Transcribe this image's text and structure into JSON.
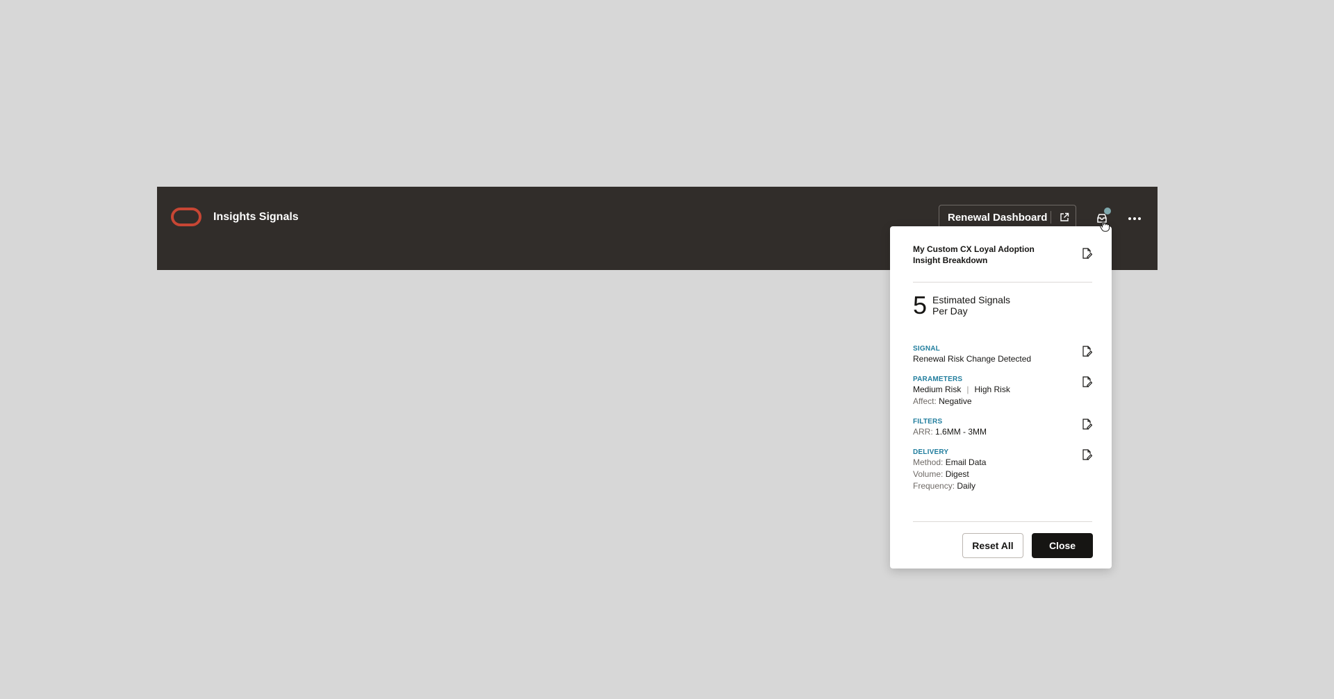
{
  "app_bar": {
    "title": "Insights Signals",
    "dashboard_button": "Renewal Dashboard",
    "icons": [
      "oracle-logo",
      "external-link-icon",
      "signal-inbox-icon",
      "more-options-icon"
    ],
    "colors": {
      "bar_background": "#312d2a",
      "logo": "#c74634",
      "notification_dot": "#7ea8ad"
    }
  },
  "popover": {
    "title": "My Custom CX Loyal Adoption Insight Breakdown",
    "metric": {
      "value": "5",
      "label": "Estimated Signals Per Day"
    },
    "signal": {
      "label": "SIGNAL",
      "value": "Renewal Risk Change Detected"
    },
    "parameters": {
      "label": "PARAMETERS",
      "risk_1": "Medium Risk",
      "separator": "|",
      "risk_2": "High Risk",
      "affect_key": "Affect:",
      "affect_value": "Negative"
    },
    "filters": {
      "label": "FILTERS",
      "arr_key": "ARR:",
      "arr_value": "1.6MM - 3MM"
    },
    "delivery": {
      "label": "DELIVERY",
      "method_key": "Method:",
      "method_value": "Email Data",
      "volume_key": "Volume:",
      "volume_value": "Digest",
      "frequency_key": "Frequency:",
      "frequency_value": "Daily"
    },
    "buttons": {
      "reset": "Reset All",
      "close": "Close"
    },
    "accent_color": "#227e9e"
  }
}
